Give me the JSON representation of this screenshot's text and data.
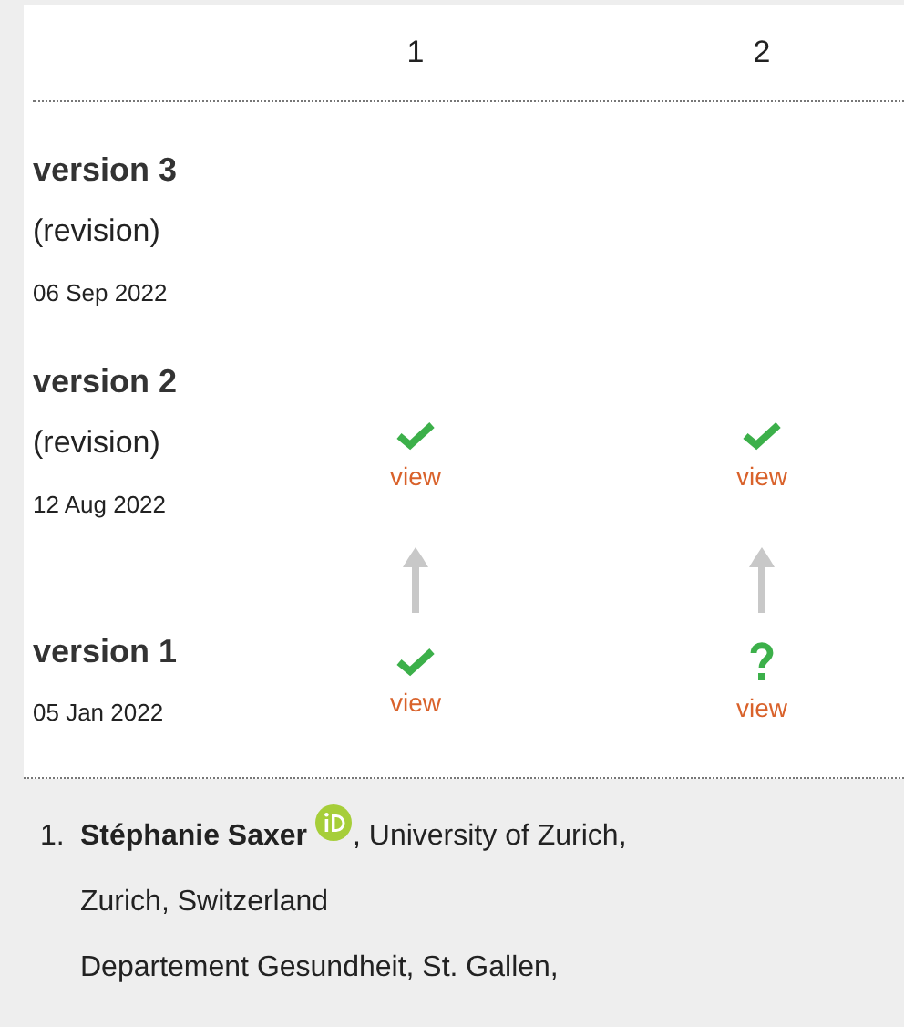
{
  "columns": [
    "1",
    "2"
  ],
  "rows": [
    {
      "kind": "version",
      "title": "version 3",
      "note": "(revision)",
      "date": "06 Sep 2022",
      "cells": []
    },
    {
      "kind": "version",
      "title": "version 2",
      "note": "(revision)",
      "date": "12 Aug 2022",
      "cells": [
        {
          "kind": "check",
          "link": "view"
        },
        {
          "kind": "check",
          "link": "view"
        }
      ]
    },
    {
      "kind": "arrows"
    },
    {
      "kind": "version",
      "title": "version 1",
      "date": "05 Jan 2022",
      "cells": [
        {
          "kind": "check",
          "link": "view"
        },
        {
          "kind": "question",
          "link": "view"
        }
      ]
    }
  ],
  "authors": [
    {
      "number": "1.",
      "name": "Stéphanie Saxer",
      "orcid": true,
      "affiliations": [
        ", University of Zurich,",
        "Zurich, Switzerland",
        "Departement Gesundheit, St. Gallen,"
      ]
    }
  ]
}
